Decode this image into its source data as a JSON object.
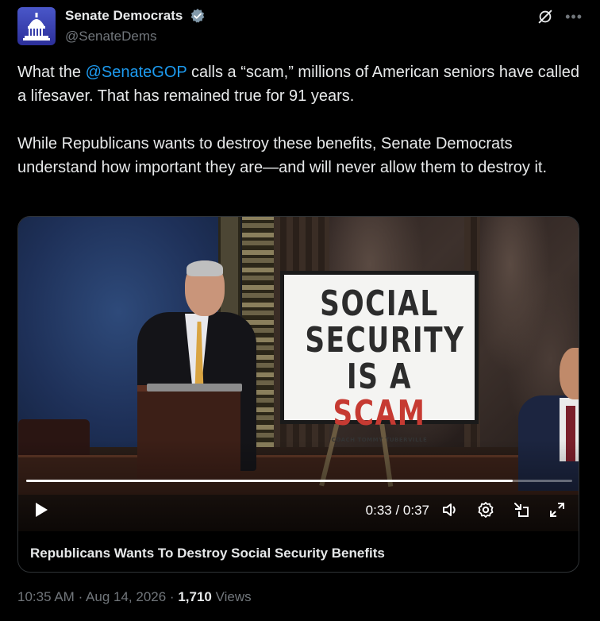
{
  "author": {
    "display_name": "Senate Democrats",
    "handle": "@SenateDems",
    "verified": true,
    "avatar_icon": "capitol-dome-icon"
  },
  "tweet": {
    "line1_prefix": "What the ",
    "mention": "@SenateGOP",
    "line1_suffix": " calls a “scam,” millions of American seniors have called a lifesaver. That has remained true for 91 years.",
    "paragraph2": "While Republicans wants to destroy these benefits, Senate Democrats understand how important they are—and will never allow them to destroy it."
  },
  "video": {
    "sign_line1": "SOCIAL",
    "sign_line2": "SECURITY",
    "sign_line3_prefix": "IS A",
    "sign_line3_highlight": "SCAM",
    "sign_credit": "COACH TOMMY TUBERVILLE",
    "current_time": "0:33",
    "duration": "0:37",
    "time_display": "0:33 / 0:37",
    "progress_fraction": 0.891,
    "title": "Republicans Wants To Destroy Social Security Benefits"
  },
  "meta": {
    "time": "10:35 AM",
    "date": "Aug 14, 2026",
    "views_count": "1,710",
    "views_label": "Views",
    "separator": "·"
  },
  "colors": {
    "accent": "#1d9bf0",
    "text": "#e7e9ea",
    "muted": "#71767b",
    "background": "#000000",
    "verified_badge": "#829aab",
    "scam_red": "#c63a32"
  }
}
